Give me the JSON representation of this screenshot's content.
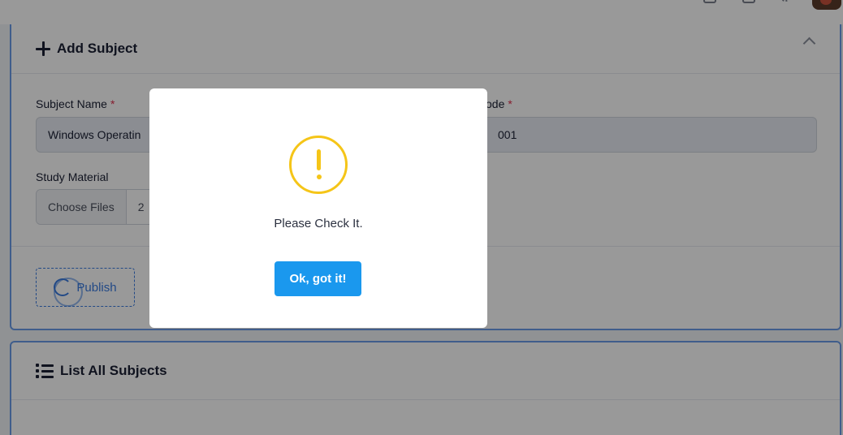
{
  "add_subject": {
    "title": "Add Subject",
    "subject_name_label": "Subject Name",
    "subject_name_value": "Windows Operatin",
    "subject_code_label": "ode",
    "subject_code_value": "001",
    "required_mark": "*",
    "study_material_label": "Study Material",
    "choose_files_label": "Choose Files",
    "files_chosen": "2",
    "publish_label": "Publish"
  },
  "list_subjects": {
    "title": "List All Subjects"
  },
  "modal": {
    "message": "Please Check It.",
    "ok_label": "Ok, got it!"
  },
  "icons": {
    "add": "plus-icon",
    "collapse": "chevron-up-icon",
    "publish": "spinner-icon",
    "list": "list-icon",
    "warning": "exclamation-circle-icon"
  },
  "colors": {
    "primary": "#1a98ee",
    "card_border": "#6b9be8",
    "warning": "#f5c518",
    "required": "#e0304d"
  }
}
